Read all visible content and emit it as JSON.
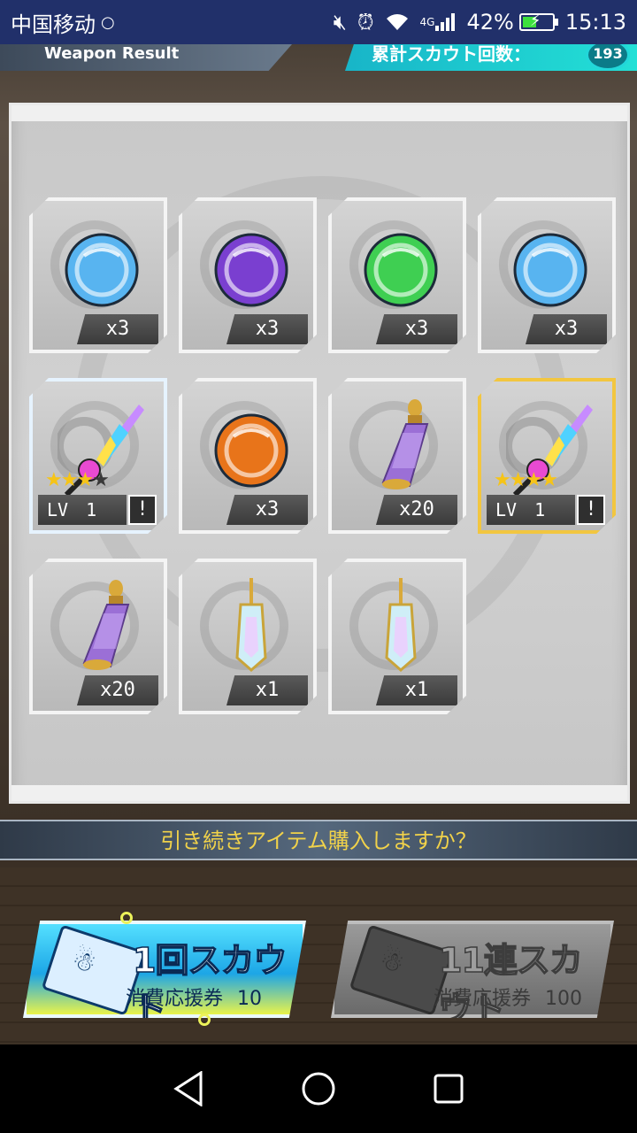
{
  "status_bar": {
    "carrier": "中国移动",
    "network": "4G",
    "battery_percent": "42%",
    "time": "15:13"
  },
  "header": {
    "left_title": "Weapon Result",
    "right_title": "累計スカウト回数：",
    "right_count": "193"
  },
  "items": [
    {
      "kind": "orb",
      "color": "#58b4f0",
      "quantity": "x3"
    },
    {
      "kind": "orb",
      "color": "#7a3fd0",
      "quantity": "x3"
    },
    {
      "kind": "orb",
      "color": "#3fcf52",
      "quantity": "x3"
    },
    {
      "kind": "orb",
      "color": "#58b4f0",
      "quantity": "x3"
    },
    {
      "kind": "weapon",
      "frame": "silver",
      "stars": 3,
      "max_stars": 4,
      "level": "LV　1",
      "locked": true
    },
    {
      "kind": "orb",
      "color": "#e8741a",
      "quantity": "x3"
    },
    {
      "kind": "potion",
      "quantity": "x20"
    },
    {
      "kind": "weapon",
      "frame": "gold",
      "stars": 4,
      "max_stars": 4,
      "level": "LV　1",
      "locked": true
    },
    {
      "kind": "potion",
      "quantity": "x20"
    },
    {
      "kind": "crystal-vial",
      "quantity": "x1"
    },
    {
      "kind": "crystal-vial",
      "quantity": "x1"
    }
  ],
  "prompt": "引き続きアイテム購入しますか？",
  "buttons": {
    "single": {
      "title": "1回スカウト",
      "cost_label": "消費応援券",
      "cost": "10"
    },
    "multi": {
      "title": "11連スカウト",
      "cost_label": "消費応援券",
      "cost": "100"
    }
  },
  "colors": {
    "status_bar": "#21306a",
    "prompt_text": "#f1d24a",
    "single_button": "#1da6e6",
    "multi_button_disabled": "#6a6a6a"
  }
}
